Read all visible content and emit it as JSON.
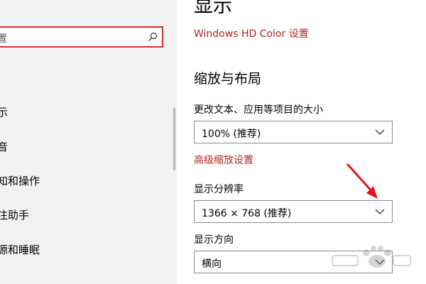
{
  "sidebar": {
    "search": {
      "placeholder": "置"
    },
    "items": [
      {
        "label": "示"
      },
      {
        "label": "音"
      },
      {
        "label": "知和操作"
      },
      {
        "label": "注助手"
      },
      {
        "label": "源和睡眠"
      }
    ]
  },
  "main": {
    "title": "显示",
    "hd_color_link": "Windows HD Color 设置",
    "scale_section": {
      "heading": "缩放与布局",
      "text_size_label": "更改文本、应用等项目的大小",
      "text_size_value": "100% (推荐)",
      "advanced_scaling_link": "高级缩放设置",
      "resolution_label": "显示分辨率",
      "resolution_value": "1366 × 768 (推荐)",
      "orientation_label": "显示方向",
      "orientation_value": "横向"
    }
  },
  "colors": {
    "accent_link": "#b3261e",
    "search_border": "#d32f2f",
    "sidebar_bg": "#f2f2f2",
    "annotation_arrow": "#e8141c"
  },
  "icons": {
    "search": "search-icon",
    "dropdown": "chevron-down-icon",
    "annotation": "red-arrow-icon",
    "watermark": "baidu-watermark-icon"
  }
}
